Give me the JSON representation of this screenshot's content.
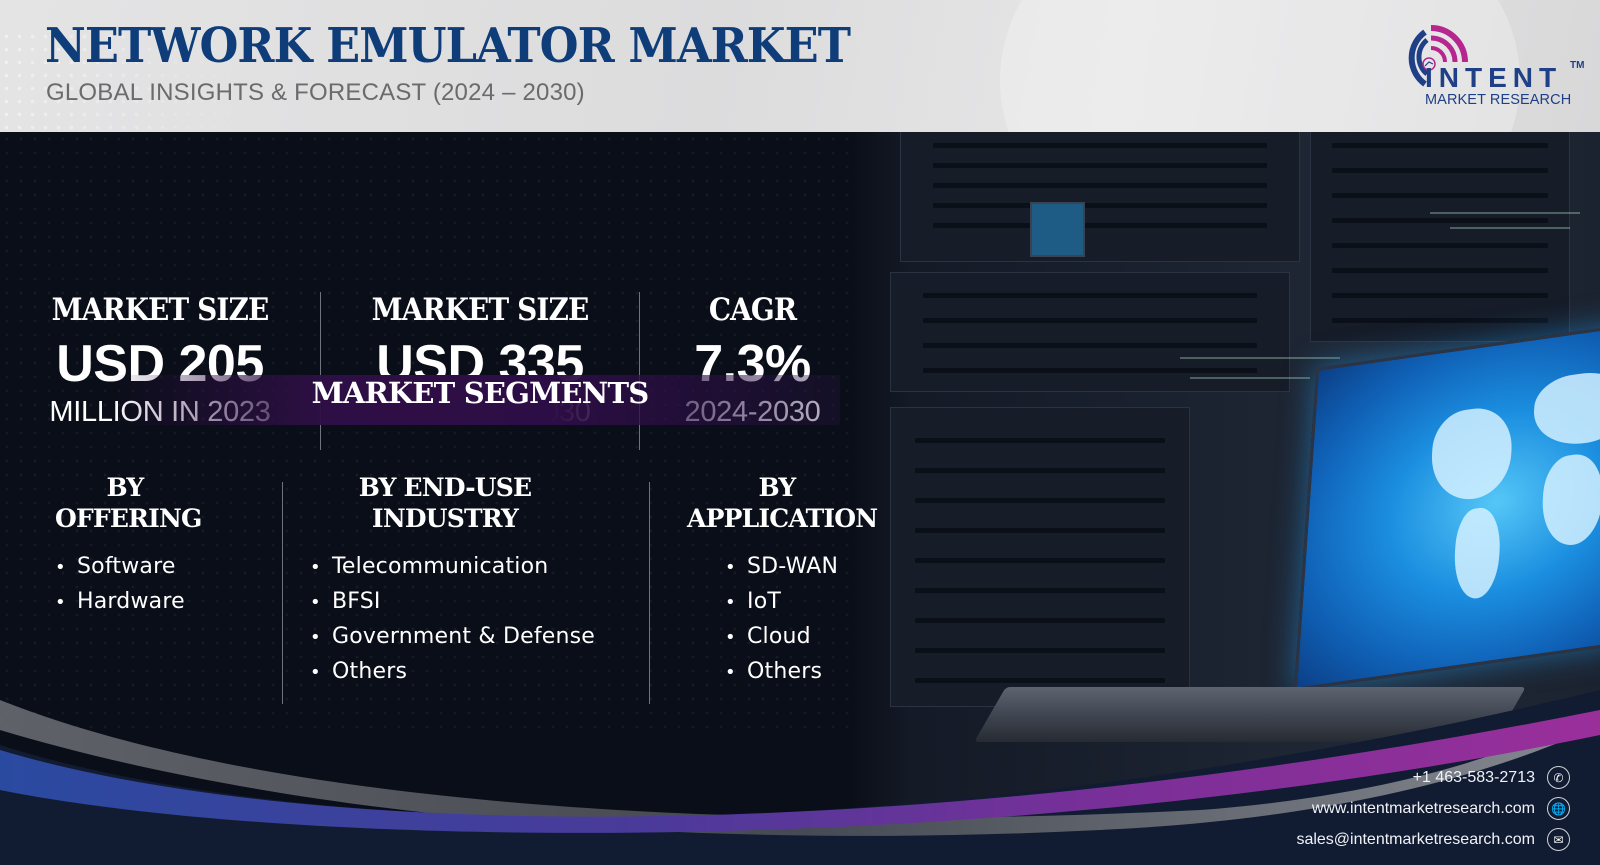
{
  "header": {
    "title": "NETWORK EMULATOR MARKET",
    "subtitle": "GLOBAL INSIGHTS & FORECAST (2024 – 2030)"
  },
  "logo": {
    "brand": "INTENT",
    "trademark": "TM",
    "tagline": "MARKET RESEARCH",
    "icon": "wifi-signal-icon"
  },
  "stats": [
    {
      "label": "MARKET SIZE",
      "value": "USD 205",
      "sub": "MILLION IN 2023"
    },
    {
      "label": "MARKET SIZE",
      "value": "USD 335",
      "sub": "MILLION IN 2030"
    },
    {
      "label": "CAGR",
      "value": "7.3%",
      "sub": "2024-2030"
    }
  ],
  "segments": {
    "title": "MARKET SEGMENTS",
    "columns": [
      {
        "heading_line1": "BY",
        "heading_line2": "OFFERING",
        "items": [
          "Software",
          "Hardware"
        ]
      },
      {
        "heading_line1": "BY END-USE",
        "heading_line2": "INDUSTRY",
        "items": [
          "Telecommunication",
          "BFSI",
          "Government & Defense",
          "Others"
        ]
      },
      {
        "heading_line1": "BY",
        "heading_line2": "APPLICATION",
        "items": [
          "SD-WAN",
          "IoT",
          "Cloud",
          "Others"
        ]
      }
    ]
  },
  "contact": {
    "phone": "+1 463-583-2713",
    "website": "www.intentmarketresearch.com",
    "email": "sales@intentmarketresearch.com"
  },
  "colors": {
    "title_blue": "#0f3d7a",
    "logo_blue": "#1f3f86",
    "logo_magenta": "#b5268f",
    "background_dark": "#0a0e18",
    "wave_purple": "#8a2f9a",
    "wave_blue": "#2a4aa0",
    "banner_purple": "#2e0f45"
  }
}
